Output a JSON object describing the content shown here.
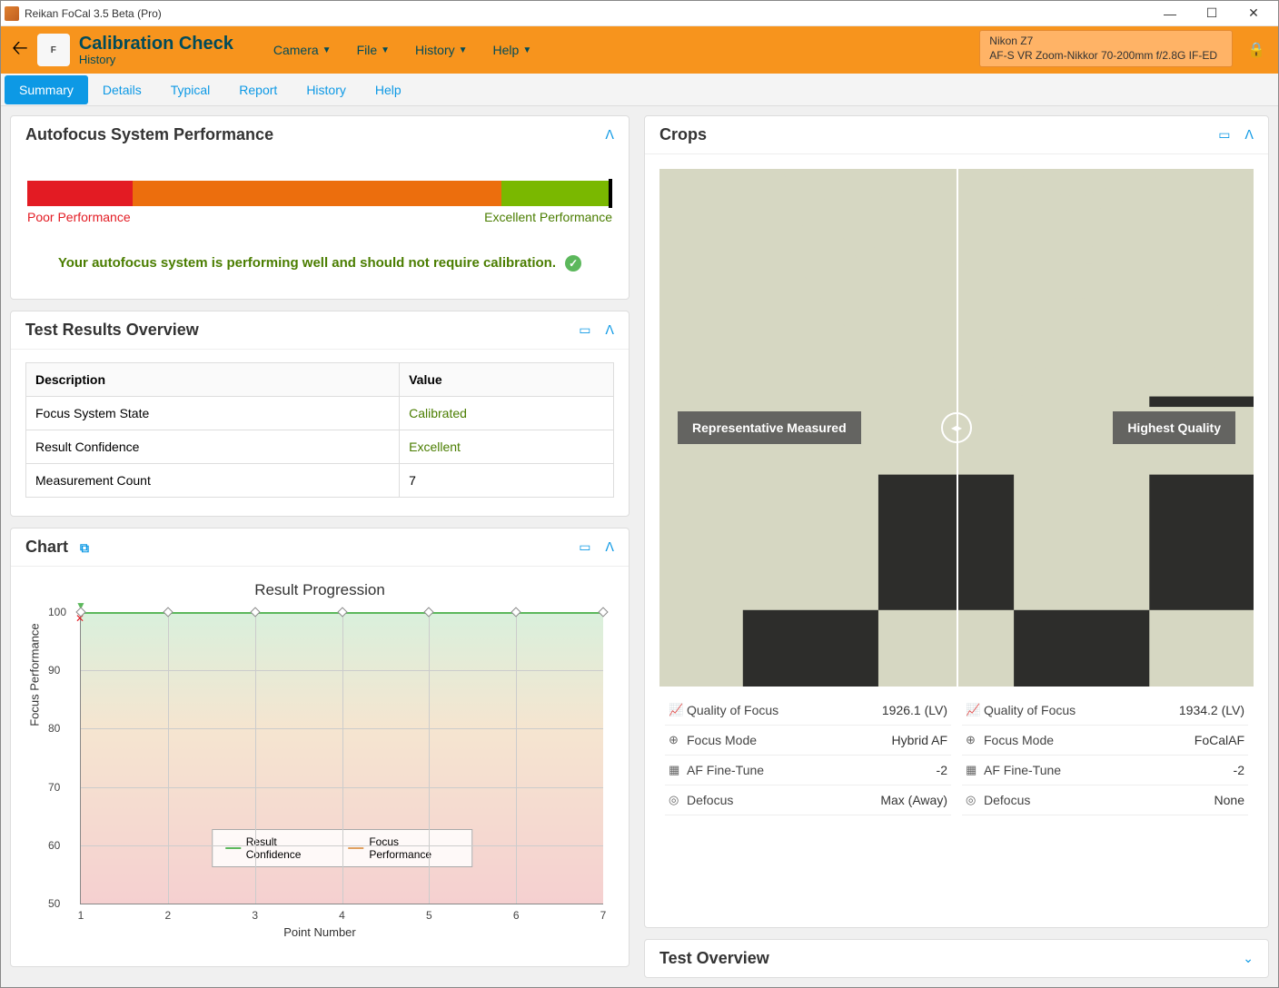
{
  "window": {
    "title": "Reikan FoCal 3.5 Beta (Pro)"
  },
  "header": {
    "title": "Calibration Check",
    "subtitle": "History",
    "menus": [
      "Camera",
      "File",
      "History",
      "Help"
    ],
    "device": {
      "camera": "Nikon Z7",
      "lens": "AF-S VR Zoom-Nikkor 70-200mm f/2.8G IF-ED"
    }
  },
  "tabs": [
    "Summary",
    "Details",
    "Typical",
    "Report",
    "History",
    "Help"
  ],
  "active_tab": "Summary",
  "panels": {
    "autofocus": {
      "title": "Autofocus System Performance",
      "poor_label": "Poor Performance",
      "excellent_label": "Excellent Performance",
      "message": "Your autofocus system is performing well and should not require calibration."
    },
    "overview": {
      "title": "Test Results Overview",
      "headers": [
        "Description",
        "Value"
      ],
      "rows": [
        {
          "desc": "Focus System State",
          "val": "Calibrated",
          "green": true
        },
        {
          "desc": "Result Confidence",
          "val": "Excellent",
          "green": true
        },
        {
          "desc": "Measurement Count",
          "val": "7",
          "green": false
        }
      ]
    },
    "chart": {
      "title": "Chart"
    },
    "crops": {
      "title": "Crops",
      "left_label": "Representative Measured",
      "right_label": "Highest Quality",
      "left_metrics": {
        "quality": "1926.1 (LV)",
        "mode": "Hybrid AF",
        "finetune": "-2",
        "defocus": "Max (Away)"
      },
      "right_metrics": {
        "quality": "1934.2 (LV)",
        "mode": "FoCalAF",
        "finetune": "-2",
        "defocus": "None"
      },
      "labels": {
        "quality": "Quality of Focus",
        "mode": "Focus Mode",
        "finetune": "AF Fine-Tune",
        "defocus": "Defocus"
      }
    },
    "test_overview": {
      "title": "Test Overview"
    }
  },
  "chart_data": {
    "type": "line",
    "title": "Result Progression",
    "xlabel": "Point Number",
    "ylabel": "Focus Performance",
    "x": [
      1,
      2,
      3,
      4,
      5,
      6,
      7
    ],
    "ylim": [
      50,
      100
    ],
    "yticks": [
      50,
      60,
      70,
      80,
      90,
      100
    ],
    "series": [
      {
        "name": "Result Confidence",
        "color": "#5cb85c",
        "values": [
          100,
          100,
          100,
          100,
          100,
          100,
          100
        ]
      },
      {
        "name": "Focus Performance",
        "color": "#e0a060",
        "values": [
          100,
          100,
          100,
          100,
          100,
          100,
          100
        ]
      }
    ],
    "legend": [
      "Result Confidence",
      "Focus Performance"
    ]
  }
}
